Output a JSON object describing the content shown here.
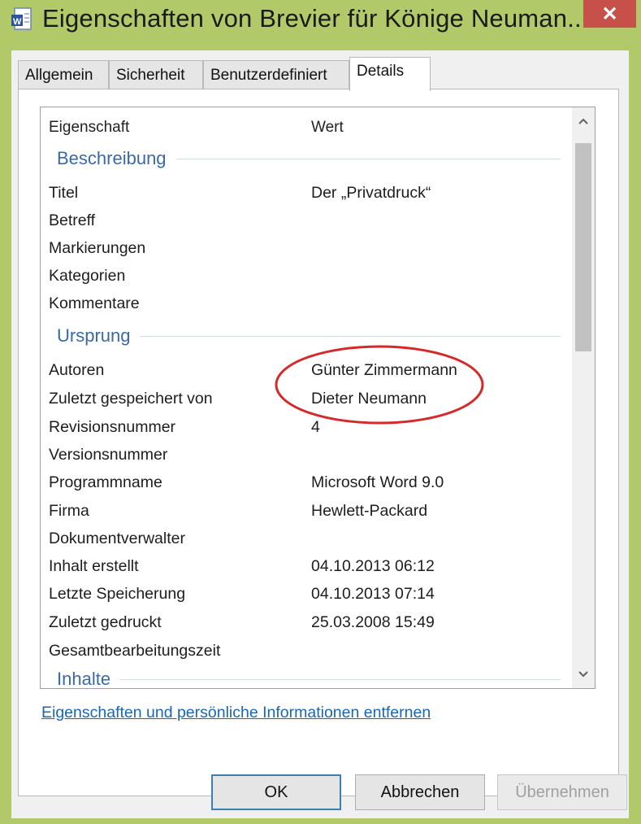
{
  "window": {
    "title": "Eigenschaften von Brevier für Könige Neuman...",
    "close_label": "✕"
  },
  "tabs": [
    {
      "label": "Allgemein"
    },
    {
      "label": "Sicherheit"
    },
    {
      "label": "Benutzerdefiniert"
    },
    {
      "label": "Details"
    }
  ],
  "active_tab": "Details",
  "table": {
    "columns": {
      "property": "Eigenschaft",
      "value": "Wert"
    },
    "groups": {
      "description": "Beschreibung",
      "origin": "Ursprung",
      "content": "Inhalte"
    },
    "rows": [
      {
        "label": "Titel",
        "value": "Der „Privatdruck“"
      },
      {
        "label": "Betreff",
        "value": ""
      },
      {
        "label": "Markierungen",
        "value": ""
      },
      {
        "label": "Kategorien",
        "value": ""
      },
      {
        "label": "Kommentare",
        "value": ""
      },
      {
        "label": "Autoren",
        "value": "Günter Zimmermann"
      },
      {
        "label": "Zuletzt gespeichert von",
        "value": "Dieter Neumann"
      },
      {
        "label": "Revisionsnummer",
        "value": "4"
      },
      {
        "label": "Versionsnummer",
        "value": ""
      },
      {
        "label": "Programmname",
        "value": "Microsoft Word 9.0"
      },
      {
        "label": "Firma",
        "value": "Hewlett-Packard"
      },
      {
        "label": "Dokumentverwalter",
        "value": ""
      },
      {
        "label": "Inhalt erstellt",
        "value": "04.10.2013 06:12"
      },
      {
        "label": "Letzte Speicherung",
        "value": "04.10.2013 07:14"
      },
      {
        "label": "Zuletzt gedruckt",
        "value": "25.03.2008 15:49"
      },
      {
        "label": "Gesamtbearbeitungszeit",
        "value": ""
      }
    ]
  },
  "link_text": "Eigenschaften und persönliche Informationen entfernen",
  "buttons": {
    "ok": "OK",
    "cancel": "Abbrechen",
    "apply": "Übernehmen"
  },
  "colors": {
    "frame": "#b2c96a",
    "close": "#c7504a",
    "group_heading": "#3a69a8",
    "link": "#1a66b5",
    "annotation_oval": "#d42a2a"
  },
  "icons": {
    "title": "word-document-icon",
    "scroll_up": "chevron-up-icon",
    "scroll_down": "chevron-down-icon"
  }
}
